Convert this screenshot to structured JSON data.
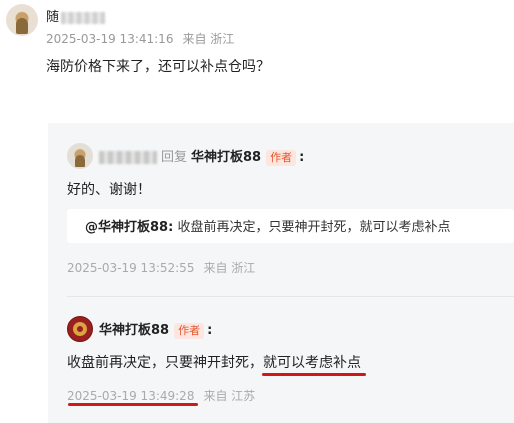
{
  "top_comment": {
    "username_visible": "随",
    "time": "2025-03-19 13:41:16",
    "location": "来自 浙江",
    "content": "海防价格下来了，还可以补点仓吗？"
  },
  "reply1": {
    "reply_word": "回复",
    "target_name": "华神打板88",
    "target_badge": "作者",
    "colon": ":",
    "content": "好的、谢谢！",
    "quote_author": "@华神打板88:",
    "quote_text": "收盘前再决定，只要神开封死，就可以考虑补点",
    "time": "2025-03-19 13:52:55",
    "location": "来自 浙江"
  },
  "reply2": {
    "author_name": "华神打板88",
    "author_badge": "作者",
    "colon": ":",
    "content_part1": "收盘前再决定，只要神开封死，",
    "content_part2": "就可以考虑补点",
    "time": "2025-03-19 13:49:28",
    "location": "来自 江苏"
  },
  "colors": {
    "badge_text": "#e4572e",
    "badge_bg": "#fde6df",
    "annotation_red": "#d01818",
    "panel_bg": "#f5f6f7"
  }
}
